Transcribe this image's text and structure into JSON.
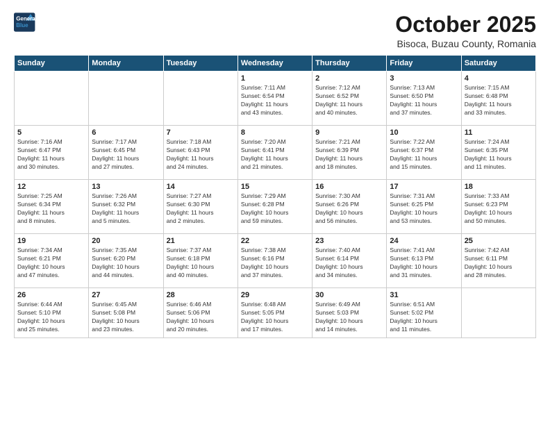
{
  "header": {
    "logo_line1": "General",
    "logo_line2": "Blue",
    "month_title": "October 2025",
    "subtitle": "Bisoca, Buzau County, Romania"
  },
  "weekdays": [
    "Sunday",
    "Monday",
    "Tuesday",
    "Wednesday",
    "Thursday",
    "Friday",
    "Saturday"
  ],
  "weeks": [
    [
      {
        "day": "",
        "info": ""
      },
      {
        "day": "",
        "info": ""
      },
      {
        "day": "",
        "info": ""
      },
      {
        "day": "1",
        "info": "Sunrise: 7:11 AM\nSunset: 6:54 PM\nDaylight: 11 hours\nand 43 minutes."
      },
      {
        "day": "2",
        "info": "Sunrise: 7:12 AM\nSunset: 6:52 PM\nDaylight: 11 hours\nand 40 minutes."
      },
      {
        "day": "3",
        "info": "Sunrise: 7:13 AM\nSunset: 6:50 PM\nDaylight: 11 hours\nand 37 minutes."
      },
      {
        "day": "4",
        "info": "Sunrise: 7:15 AM\nSunset: 6:48 PM\nDaylight: 11 hours\nand 33 minutes."
      }
    ],
    [
      {
        "day": "5",
        "info": "Sunrise: 7:16 AM\nSunset: 6:47 PM\nDaylight: 11 hours\nand 30 minutes."
      },
      {
        "day": "6",
        "info": "Sunrise: 7:17 AM\nSunset: 6:45 PM\nDaylight: 11 hours\nand 27 minutes."
      },
      {
        "day": "7",
        "info": "Sunrise: 7:18 AM\nSunset: 6:43 PM\nDaylight: 11 hours\nand 24 minutes."
      },
      {
        "day": "8",
        "info": "Sunrise: 7:20 AM\nSunset: 6:41 PM\nDaylight: 11 hours\nand 21 minutes."
      },
      {
        "day": "9",
        "info": "Sunrise: 7:21 AM\nSunset: 6:39 PM\nDaylight: 11 hours\nand 18 minutes."
      },
      {
        "day": "10",
        "info": "Sunrise: 7:22 AM\nSunset: 6:37 PM\nDaylight: 11 hours\nand 15 minutes."
      },
      {
        "day": "11",
        "info": "Sunrise: 7:24 AM\nSunset: 6:35 PM\nDaylight: 11 hours\nand 11 minutes."
      }
    ],
    [
      {
        "day": "12",
        "info": "Sunrise: 7:25 AM\nSunset: 6:34 PM\nDaylight: 11 hours\nand 8 minutes."
      },
      {
        "day": "13",
        "info": "Sunrise: 7:26 AM\nSunset: 6:32 PM\nDaylight: 11 hours\nand 5 minutes."
      },
      {
        "day": "14",
        "info": "Sunrise: 7:27 AM\nSunset: 6:30 PM\nDaylight: 11 hours\nand 2 minutes."
      },
      {
        "day": "15",
        "info": "Sunrise: 7:29 AM\nSunset: 6:28 PM\nDaylight: 10 hours\nand 59 minutes."
      },
      {
        "day": "16",
        "info": "Sunrise: 7:30 AM\nSunset: 6:26 PM\nDaylight: 10 hours\nand 56 minutes."
      },
      {
        "day": "17",
        "info": "Sunrise: 7:31 AM\nSunset: 6:25 PM\nDaylight: 10 hours\nand 53 minutes."
      },
      {
        "day": "18",
        "info": "Sunrise: 7:33 AM\nSunset: 6:23 PM\nDaylight: 10 hours\nand 50 minutes."
      }
    ],
    [
      {
        "day": "19",
        "info": "Sunrise: 7:34 AM\nSunset: 6:21 PM\nDaylight: 10 hours\nand 47 minutes."
      },
      {
        "day": "20",
        "info": "Sunrise: 7:35 AM\nSunset: 6:20 PM\nDaylight: 10 hours\nand 44 minutes."
      },
      {
        "day": "21",
        "info": "Sunrise: 7:37 AM\nSunset: 6:18 PM\nDaylight: 10 hours\nand 40 minutes."
      },
      {
        "day": "22",
        "info": "Sunrise: 7:38 AM\nSunset: 6:16 PM\nDaylight: 10 hours\nand 37 minutes."
      },
      {
        "day": "23",
        "info": "Sunrise: 7:40 AM\nSunset: 6:14 PM\nDaylight: 10 hours\nand 34 minutes."
      },
      {
        "day": "24",
        "info": "Sunrise: 7:41 AM\nSunset: 6:13 PM\nDaylight: 10 hours\nand 31 minutes."
      },
      {
        "day": "25",
        "info": "Sunrise: 7:42 AM\nSunset: 6:11 PM\nDaylight: 10 hours\nand 28 minutes."
      }
    ],
    [
      {
        "day": "26",
        "info": "Sunrise: 6:44 AM\nSunset: 5:10 PM\nDaylight: 10 hours\nand 25 minutes."
      },
      {
        "day": "27",
        "info": "Sunrise: 6:45 AM\nSunset: 5:08 PM\nDaylight: 10 hours\nand 23 minutes."
      },
      {
        "day": "28",
        "info": "Sunrise: 6:46 AM\nSunset: 5:06 PM\nDaylight: 10 hours\nand 20 minutes."
      },
      {
        "day": "29",
        "info": "Sunrise: 6:48 AM\nSunset: 5:05 PM\nDaylight: 10 hours\nand 17 minutes."
      },
      {
        "day": "30",
        "info": "Sunrise: 6:49 AM\nSunset: 5:03 PM\nDaylight: 10 hours\nand 14 minutes."
      },
      {
        "day": "31",
        "info": "Sunrise: 6:51 AM\nSunset: 5:02 PM\nDaylight: 10 hours\nand 11 minutes."
      },
      {
        "day": "",
        "info": ""
      }
    ]
  ]
}
